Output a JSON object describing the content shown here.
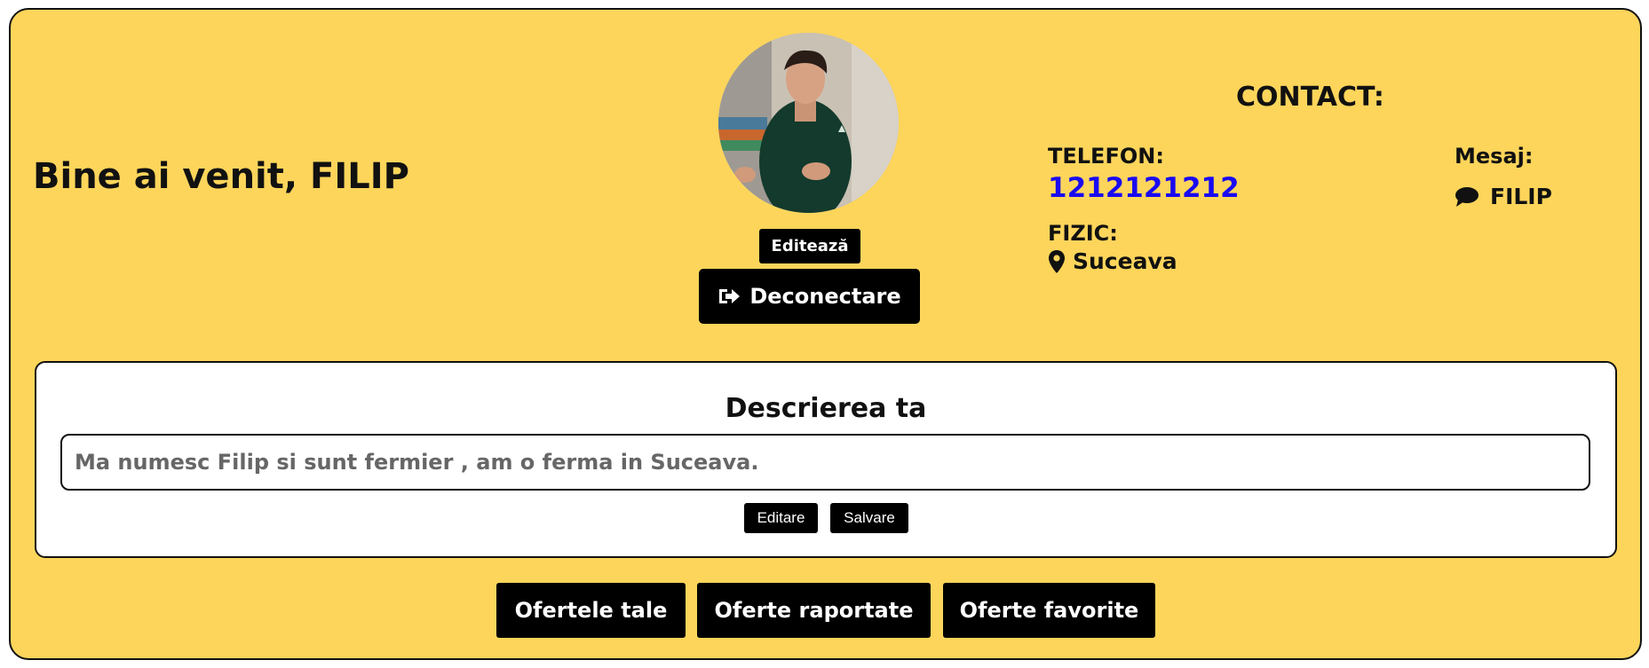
{
  "header": {
    "welcome": "Bine ai venit, FILIP"
  },
  "profile": {
    "edit_label": "Editează",
    "logout_label": "Deconectare",
    "logout_icon": "sign-out-icon"
  },
  "contact": {
    "title": "CONTACT:",
    "phone_label": "TELEFON:",
    "phone": "1212121212",
    "physical_label": "FIZIC:",
    "location": "Suceava",
    "location_icon": "map-marker-icon",
    "message_label": "Mesaj:",
    "message_user": "FILIP",
    "message_icon": "chat-bubble-icon"
  },
  "description": {
    "title": "Descrierea ta",
    "text": "Ma numesc Filip si sunt fermier , am o ferma in Suceava.",
    "edit_label": "Editare",
    "save_label": "Salvare"
  },
  "tabs": [
    "Ofertele tale",
    "Oferte raportate",
    "Oferte favorite"
  ],
  "colors": {
    "background": "#fdd55b",
    "button": "#000000",
    "phone_link": "#1a0af0"
  }
}
